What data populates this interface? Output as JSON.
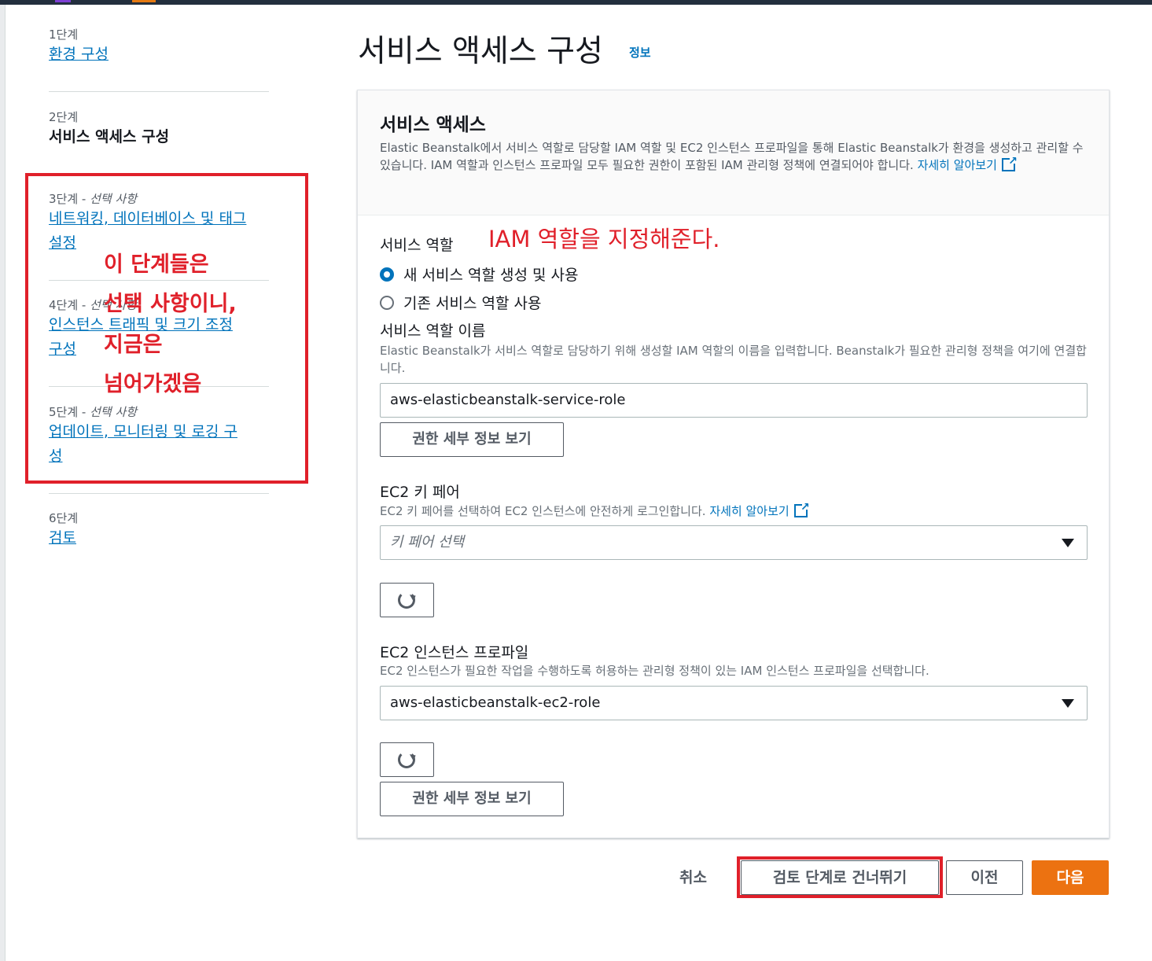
{
  "sidebar": {
    "steps": [
      {
        "num": "1단계",
        "label": "환경 구성"
      },
      {
        "num": "2단계",
        "label": "서비스 액세스 구성"
      },
      {
        "num": "3단계",
        "optional": "선택 사항",
        "label_line1": "네트워킹, 데이터베이스 및 태그",
        "label_line2": "설정"
      },
      {
        "num": "4단계",
        "optional": "선택 사항",
        "label_line1": "인스턴스 트래픽 및 크기 조정",
        "label_line2": "구성"
      },
      {
        "num": "5단계",
        "optional": "선택 사항",
        "label_line1": "업데이트, 모니터링 및 로깅 구",
        "label_line2": "성"
      },
      {
        "num": "6단계",
        "label": "검토"
      }
    ],
    "separator": " - "
  },
  "annotation": {
    "left_lines": [
      "이 단계들은",
      "선택 사항이니,",
      "지금은",
      "넘어가겠음"
    ],
    "role_note": "IAM 역할을 지정해준다.",
    "color": "#e0202a"
  },
  "page": {
    "title": "서비스 액세스 구성",
    "info": "정보"
  },
  "panel": {
    "title": "서비스 액세스",
    "desc": "Elastic Beanstalk에서 서비스 역할로 담당할 IAM 역할 및 EC2 인스턴스 프로파일을 통해 Elastic Beanstalk가 환경을 생성하고 관리할 수 있습니다. IAM 역할과 인스턴스 프로파일 모두 필요한 권한이 포함된 IAM 관리형 정책에 연결되어야 합니다.",
    "learn_more": "자세히 알아보기",
    "service_role": {
      "label": "서비스 역할",
      "option_new": "새 서비스 역할 생성 및 사용",
      "option_existing": "기존 서비스 역할 사용",
      "name_label": "서비스 역할 이름",
      "name_desc": "Elastic Beanstalk가 서비스 역할로 담당하기 위해 생성할 IAM 역할의 이름을 입력합니다. Beanstalk가 필요한 관리형 정책을 여기에 연결합니다.",
      "name_value": "aws-elasticbeanstalk-service-role",
      "view_permissions": "권한 세부 정보 보기"
    },
    "key_pair": {
      "label": "EC2 키 페어",
      "desc": "EC2 키 페어를 선택하여 EC2 인스턴스에 안전하게 로그인합니다.",
      "learn_more": "자세히 알아보기",
      "placeholder": "키 페어 선택"
    },
    "instance_profile": {
      "label": "EC2 인스턴스 프로파일",
      "desc": "EC2 인스턴스가 필요한 작업을 수행하도록 허용하는 관리형 정책이 있는 IAM 인스턴스 프로파일을 선택합니다.",
      "value": "aws-elasticbeanstalk-ec2-role",
      "view_permissions": "권한 세부 정보 보기"
    }
  },
  "footer": {
    "cancel": "취소",
    "skip_to_review": "검토 단계로 건너뛰기",
    "previous": "이전",
    "next": "다음"
  },
  "colors": {
    "link": "#0073bb",
    "primary": "#ec7211",
    "topbar": "#232f3e"
  }
}
